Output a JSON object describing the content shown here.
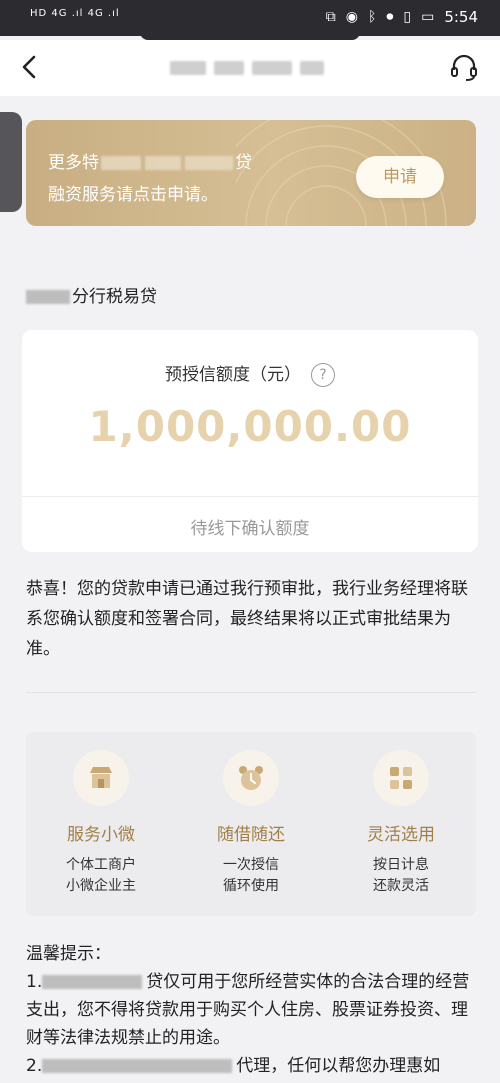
{
  "status_bar": {
    "left": "HD 4G .ıl 4G .ıl",
    "time": "5:54"
  },
  "nav": {
    "back_icon": "chevron-left-icon",
    "support_icon": "headset-icon"
  },
  "banner": {
    "line1": "更多特",
    "line1_end": "贷",
    "line2": "融资服务请点击申请。",
    "apply_label": "申请"
  },
  "product": {
    "title": "分行税易贷"
  },
  "credit": {
    "label": "预授信额度（元）",
    "help_glyph": "?",
    "amount": "1,000,000.00",
    "status": "待线下确认额度"
  },
  "notice": "恭喜！您的贷款申请已通过我行预审批，我行业务经理将联系您确认额度和签署合同，最终结果将以正式审批结果为准。",
  "features": [
    {
      "title": "服务小微",
      "desc1": "个体工商户",
      "desc2": "小微企业主",
      "icon": "shop-icon"
    },
    {
      "title": "随借随还",
      "desc1": "一次授信",
      "desc2": "循环使用",
      "icon": "alarm-clock-icon"
    },
    {
      "title": "灵活选用",
      "desc1": "按日计息",
      "desc2": "还款灵活",
      "icon": "grid-icon"
    }
  ],
  "tips": {
    "heading": "温馨提示：",
    "item1_prefix": "1.",
    "item1_text": "贷仅可用于您所经营实体的合法合理的经营支出，您不得将贷款用于购买个人住房、股票证券投资、理财等法律法规禁止的用途。",
    "item2_prefix": "2.",
    "item2_text": "代理，任何以帮您办理惠如"
  },
  "colors": {
    "gold": "#c8ae82",
    "gold_text": "#a27f47",
    "amount": "#e7d2ae"
  }
}
